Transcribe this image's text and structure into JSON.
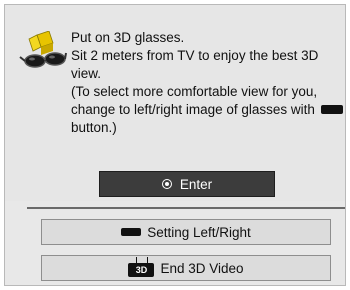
{
  "dialog": {
    "message_line1": "Put on 3D glasses.",
    "message_line2": "Sit 2 meters from TV to enjoy the best 3D view.",
    "message_line3a": "(To select more comfortable view for you, change to left/right image of glasses with",
    "message_line3b": "button.)",
    "enter_label": "Enter",
    "setting_label": "Setting Left/Right",
    "end3d_label": "End 3D Video",
    "key_3d_text": "3D"
  },
  "icons": {
    "glasses": "3d-glasses-icon",
    "enter": "enter-circle-icon",
    "black_key": "black-color-key-icon",
    "key_3d": "3d-key-icon"
  },
  "colors": {
    "enter_bg": "#3c3c3c",
    "panel_bg": "#e6e6e6",
    "button_bg": "#dcdcdc"
  }
}
